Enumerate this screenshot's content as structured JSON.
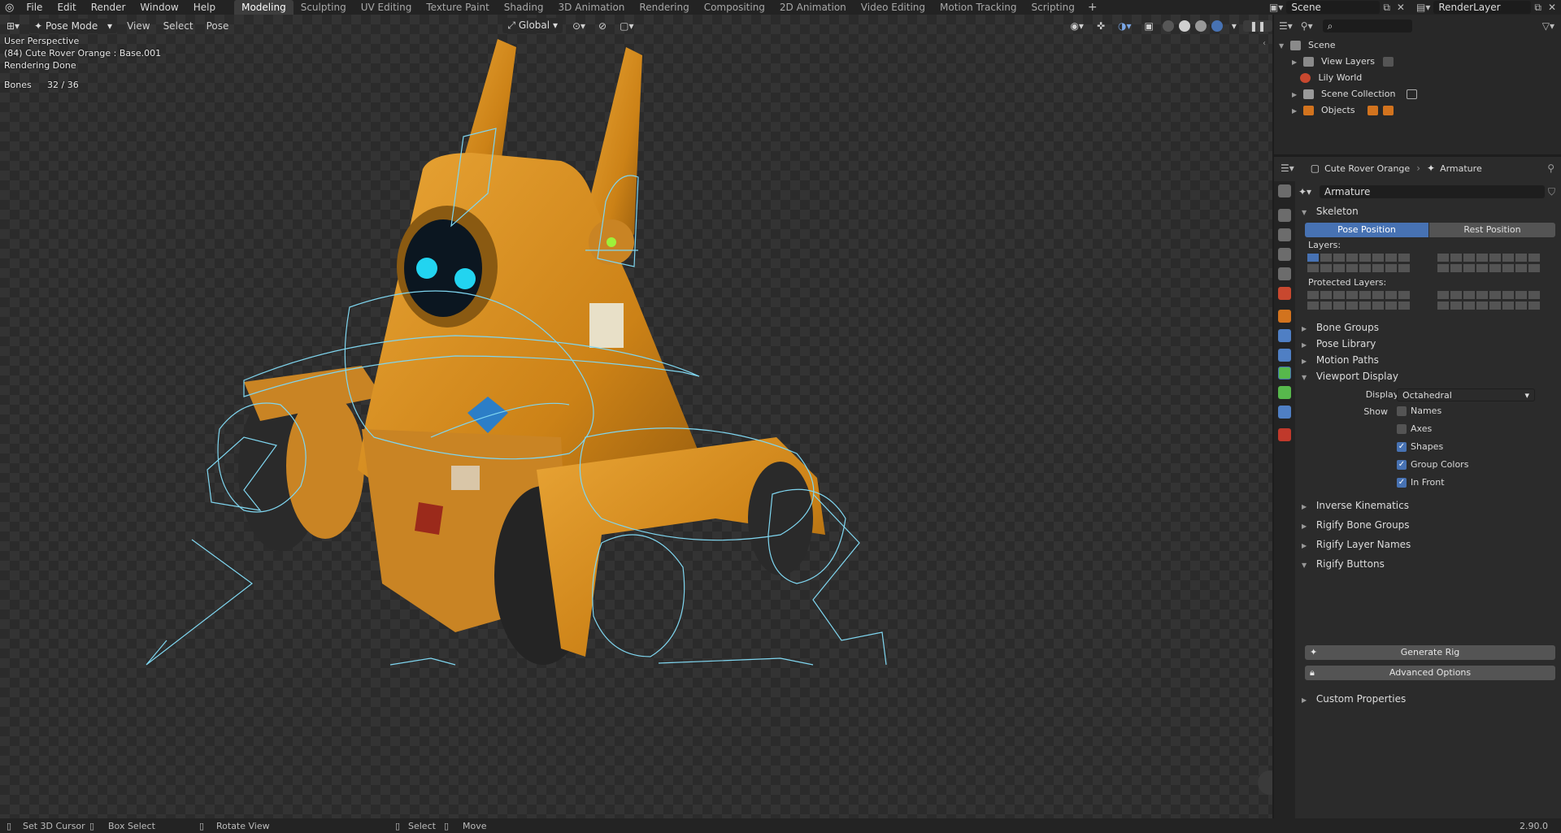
{
  "menu": [
    "File",
    "Edit",
    "Render",
    "Window",
    "Help"
  ],
  "workspaces": [
    "Modeling",
    "Sculpting",
    "UV Editing",
    "Texture Paint",
    "Shading",
    "3D Animation",
    "Rendering",
    "Compositing",
    "2D Animation",
    "Video Editing",
    "Motion Tracking",
    "Scripting"
  ],
  "active_workspace": "Modeling",
  "scene_field": "Scene",
  "render_layer_field": "RenderLayer",
  "viewport": {
    "mode": "Pose Mode",
    "header_menus": [
      "View",
      "Select",
      "Pose"
    ],
    "orientation": "Global",
    "overlay_lines": [
      "User Perspective",
      "(84) Cute Rover Orange : Base.001",
      "Rendering Done"
    ],
    "bones_label": "Bones",
    "bones_value": "32 / 36"
  },
  "outliner": {
    "items": [
      {
        "label": "Scene",
        "icon": "scene-icon"
      },
      {
        "label": "View Layers",
        "icon": "view-layers-icon"
      },
      {
        "label": "Lily World",
        "icon": "world-icon"
      },
      {
        "label": "Scene Collection",
        "icon": "collection-icon"
      },
      {
        "label": "Objects",
        "icon": "objects-icon"
      }
    ]
  },
  "properties": {
    "object_name": "Cute Rover Orange",
    "data_name": "Armature",
    "datablock": "Armature",
    "skeleton": {
      "title": "Skeleton",
      "pose_position": "Pose Position",
      "rest_position": "Rest Position",
      "layers_label": "Layers:",
      "protected_label": "Protected Layers:"
    },
    "collapsed_a": [
      "Bone Groups",
      "Pose Library",
      "Motion Paths"
    ],
    "viewport_display": {
      "title": "Viewport Display",
      "display_as_label": "Display As",
      "display_as_value": "Octahedral",
      "show_label": "Show",
      "options": [
        {
          "label": "Names",
          "checked": false
        },
        {
          "label": "Axes",
          "checked": false
        },
        {
          "label": "Shapes",
          "checked": true
        },
        {
          "label": "Group Colors",
          "checked": true
        },
        {
          "label": "In Front",
          "checked": true
        }
      ]
    },
    "collapsed_b": [
      "Inverse Kinematics",
      "Rigify Bone Groups",
      "Rigify Layer Names"
    ],
    "rigify_buttons": {
      "title": "Rigify Buttons",
      "generate": "Generate Rig",
      "advanced": "Advanced Options"
    },
    "custom_properties": "Custom Properties"
  },
  "status": {
    "items": [
      "Set 3D Cursor",
      "Box Select",
      "Rotate View",
      "Select",
      "Move"
    ],
    "version": "2.90.0"
  },
  "colors": {
    "accent": "#4772b3",
    "rig": "#7fd6f0",
    "robot": "#d88f1e"
  }
}
